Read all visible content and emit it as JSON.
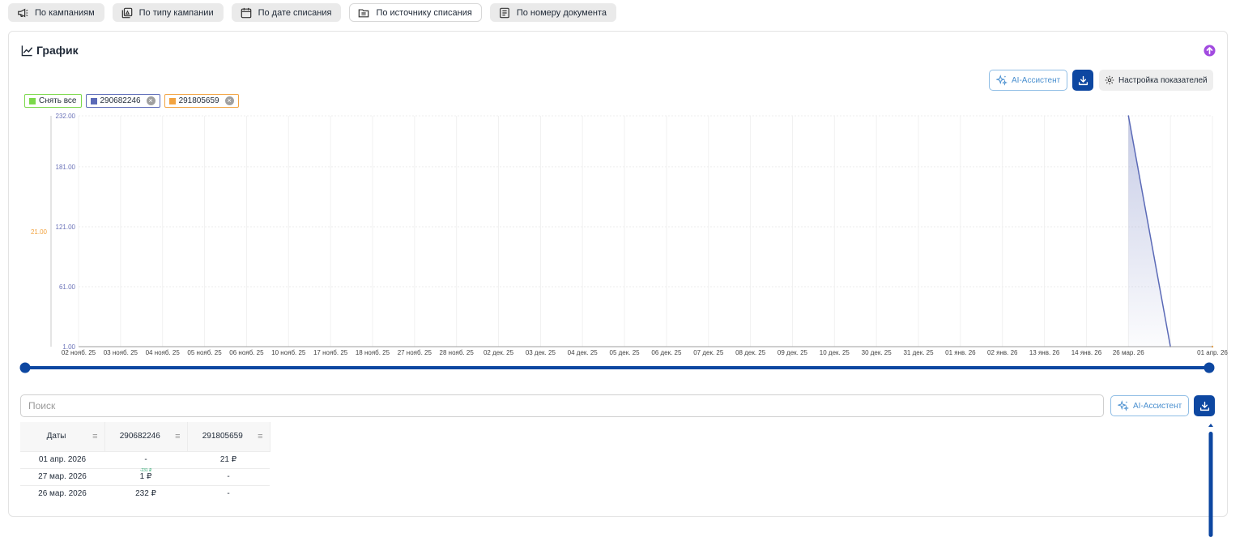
{
  "tabs": [
    {
      "label": "По кампаниям",
      "icon": "megaphone-icon",
      "active": false
    },
    {
      "label": "По типу кампании",
      "icon": "image-box-icon",
      "active": false
    },
    {
      "label": "По дате списания",
      "icon": "calendar-icon",
      "active": false
    },
    {
      "label": "По источнику списания",
      "icon": "folder-list-icon",
      "active": true
    },
    {
      "label": "По номеру документа",
      "icon": "document-icon",
      "active": false
    }
  ],
  "card": {
    "title": "График",
    "ai_label": "AI-Ассистент",
    "settings_label": "Настройка показателей"
  },
  "legend": {
    "uncheck_all": "Снять все",
    "series": [
      {
        "name": "290682246",
        "color": "#5b6ab7"
      },
      {
        "name": "291805659",
        "color": "#f2a340"
      }
    ]
  },
  "colors": {
    "accent": "#0d47a1",
    "uncheck_all": "#7bd84a",
    "series_blue": "#5b6ab7",
    "series_orange": "#f2a340",
    "ai_border": "#8fbde5",
    "up_badge": "#a24be0"
  },
  "chart_data": {
    "type": "line",
    "x": [
      "02 нояб. 25",
      "03 нояб. 25",
      "04 нояб. 25",
      "05 нояб. 25",
      "06 нояб. 25",
      "10 нояб. 25",
      "17 нояб. 25",
      "18 нояб. 25",
      "27 нояб. 25",
      "28 нояб. 25",
      "02 дек. 25",
      "03 дек. 25",
      "04 дек. 25",
      "05 дек. 25",
      "06 дек. 25",
      "07 дек. 25",
      "08 дек. 25",
      "09 дек. 25",
      "10 дек. 25",
      "30 дек. 25",
      "31 дек. 25",
      "01 янв. 26",
      "02 янв. 26",
      "13 янв. 26",
      "14 янв. 26",
      "26 мар. 26",
      "27 мар. 26",
      "01 апр. 26"
    ],
    "x_ticks": [
      "02 нояб. 25",
      "03 нояб. 25",
      "04 нояб. 25",
      "05 нояб. 25",
      "06 нояб. 25",
      "10 нояб. 25",
      "17 нояб. 25",
      "18 нояб. 25",
      "27 нояб. 25",
      "28 нояб. 25",
      "02 дек. 25",
      "03 дек. 25",
      "04 дек. 25",
      "05 дек. 25",
      "06 дек. 25",
      "07 дек. 25",
      "08 дек. 25",
      "09 дек. 25",
      "10 дек. 25",
      "30 дек. 25",
      "31 дек. 25",
      "01 янв. 26",
      "02 янв. 26",
      "13 янв. 26",
      "14 янв. 26",
      "26 мар. 26",
      "01 апр. 26"
    ],
    "y_ticks": [
      "1.00",
      "61.00",
      "121.00",
      "181.00",
      "232.00"
    ],
    "y2_ticks": [
      "21.00"
    ],
    "ylim": [
      1,
      232
    ],
    "grid": true,
    "series": [
      {
        "name": "290682246",
        "points": [
          {
            "x": "26 мар. 26",
            "y": 232
          },
          {
            "x": "27 мар. 26",
            "y": 1
          }
        ]
      },
      {
        "name": "291805659",
        "points": [
          {
            "x": "01 апр. 26",
            "y": 21
          }
        ]
      }
    ]
  },
  "table": {
    "search_placeholder": "Поиск",
    "ai_label": "AI-Ассистент",
    "columns": [
      "Даты",
      "290682246",
      "291805659"
    ],
    "rows": [
      {
        "date": "01 апр. 2026",
        "v1": "-",
        "v1_delta": "",
        "v2": "21 ₽"
      },
      {
        "date": "27 мар. 2026",
        "v1": "1 ₽",
        "v1_delta": "-231 ₽",
        "v2": "-"
      },
      {
        "date": "26 мар. 2026",
        "v1": "232 ₽",
        "v1_delta": "",
        "v2": "-"
      }
    ]
  }
}
